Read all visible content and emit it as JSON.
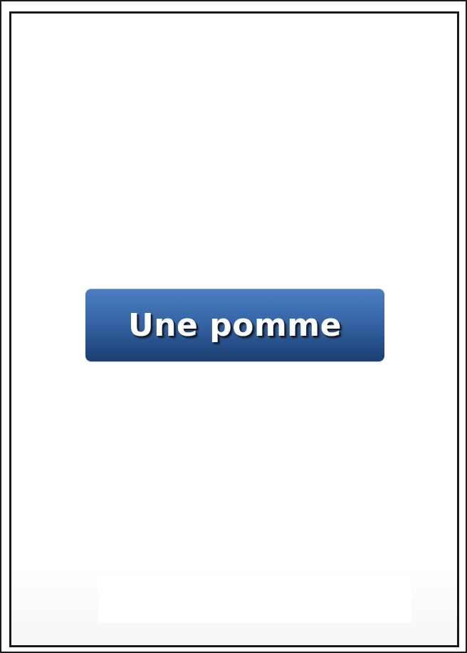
{
  "choice_button": {
    "label": "Une pomme"
  },
  "colors": {
    "button_top": "#4a7ec2",
    "button_bottom": "#1c3f6f",
    "frame_border": "#1a1a1a",
    "background": "#ffffff"
  }
}
